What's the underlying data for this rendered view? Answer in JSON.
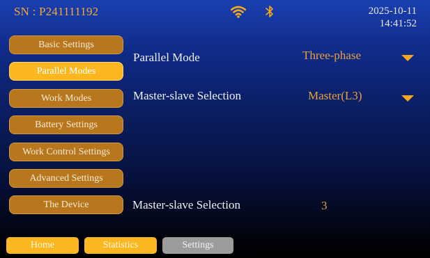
{
  "status_bar": {
    "serial": "SN : P241111192",
    "date": "2025-10-11",
    "time": "14:41:52",
    "wifi_icon": "wifi-icon",
    "bluetooth_icon": "bluetooth-icon"
  },
  "menu": [
    {
      "label": "Basic Settings",
      "active": false
    },
    {
      "label": "Parallel Modes",
      "active": true
    },
    {
      "label": "Work Modes",
      "active": false
    },
    {
      "label": "Battery Settings",
      "active": false
    },
    {
      "label": "Work Control Settings",
      "active": false
    },
    {
      "label": "Advanced Settings",
      "active": false
    },
    {
      "label": "The Device",
      "active": false
    }
  ],
  "settings": {
    "parallel_mode": {
      "label": "Parallel Mode",
      "value": "Three-phase"
    },
    "master_slave": {
      "label": "Master-slave Selection",
      "value": "Master(L3)"
    },
    "master_slave_count": {
      "label": "Master-slave Selection",
      "value": "3"
    }
  },
  "bottom_nav": {
    "home": "Home",
    "statistics": "Statistics",
    "settings": "Settings"
  },
  "colors": {
    "accent": "#fbb71f",
    "menu_button": "#b8761d",
    "value_text": "#e8a23a",
    "inactive_nav": "#9c9c9c"
  }
}
